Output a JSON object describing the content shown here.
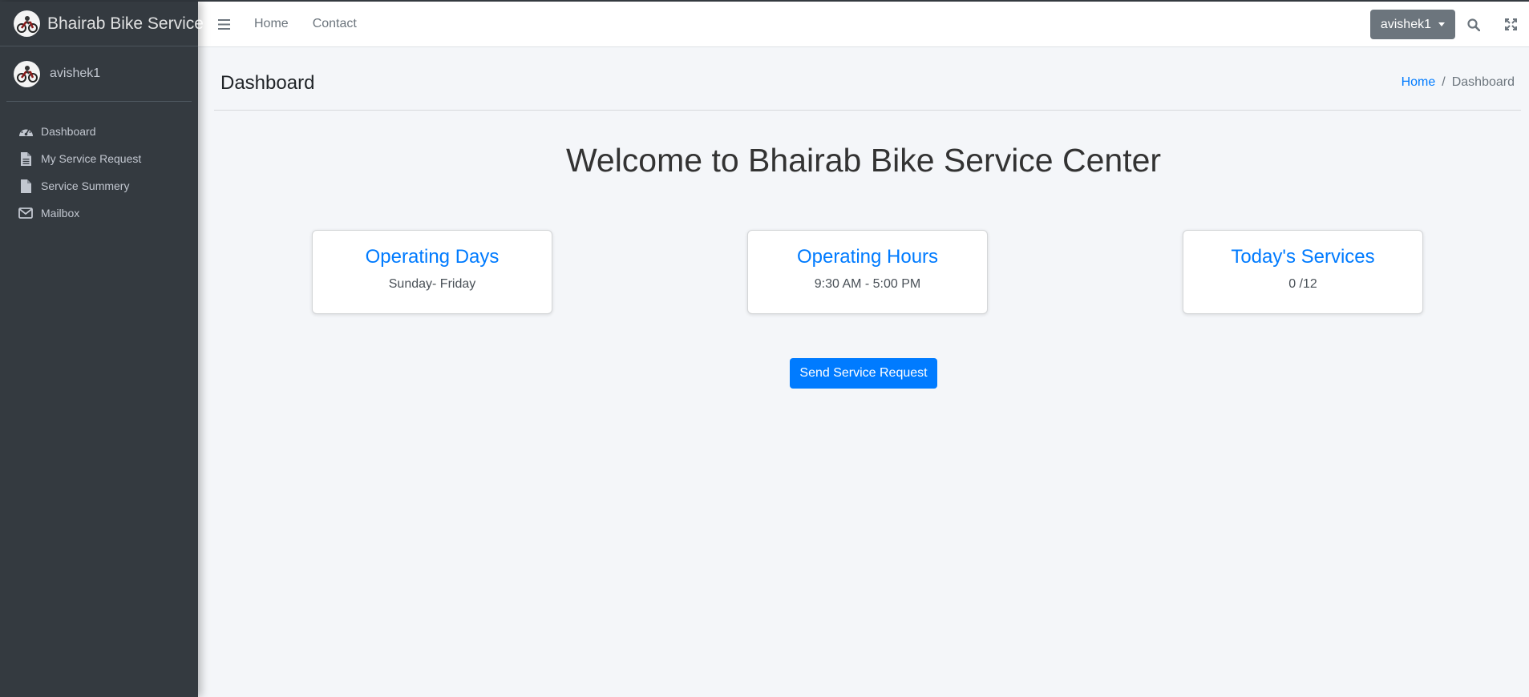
{
  "brand": {
    "name": "Bhairab Bike Service",
    "logo_icon": "motorbike-icon"
  },
  "user": {
    "name": "avishek1",
    "avatar_icon": "motorbike-icon"
  },
  "sidebar": {
    "items": [
      {
        "label": "Dashboard",
        "icon": "tachometer-icon"
      },
      {
        "label": "My Service Request",
        "icon": "file-text-icon"
      },
      {
        "label": "Service Summery",
        "icon": "file-icon"
      },
      {
        "label": "Mailbox",
        "icon": "envelope-icon"
      }
    ]
  },
  "topbar": {
    "links": [
      "Home",
      "Contact"
    ],
    "user_dropdown": "avishek1"
  },
  "header": {
    "title": "Dashboard",
    "breadcrumb": {
      "home": "Home",
      "separator": "/",
      "current": "Dashboard"
    }
  },
  "main": {
    "welcome": "Welcome to Bhairab Bike Service Center",
    "cards": [
      {
        "title": "Operating Days",
        "text": "Sunday- Friday"
      },
      {
        "title": "Operating Hours",
        "text": "9:30 AM - 5:00 PM"
      },
      {
        "title": "Today's Services",
        "text": "0 /12"
      }
    ],
    "cta_label": "Send Service Request"
  },
  "colors": {
    "sidebar_bg": "#343a40",
    "primary": "#007bff",
    "secondary": "#6c757d",
    "content_bg": "#f4f6f9"
  }
}
